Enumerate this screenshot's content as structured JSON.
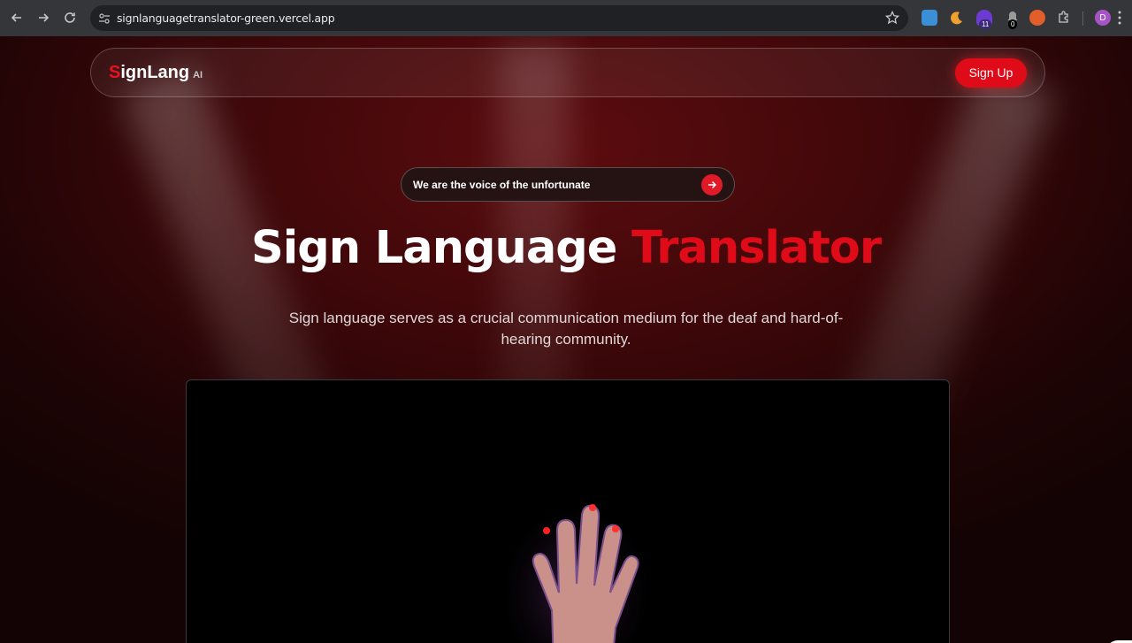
{
  "browser": {
    "url": "signlanguagetranslator-green.vercel.app",
    "extensions": [
      {
        "name": "bear-extension-icon",
        "color": "#3a8fd6"
      },
      {
        "name": "moon-extension-icon",
        "color": "#f0a12b"
      },
      {
        "name": "purple-extension-icon",
        "color": "#6c3bd1",
        "badge": "11"
      },
      {
        "name": "bell-extension-icon",
        "color": "#2a2a2a",
        "badge": "0"
      },
      {
        "name": "firefox-like-extension-icon",
        "color": "#e25e2a"
      }
    ],
    "profile_initial": "D"
  },
  "nav": {
    "logo_s": "S",
    "logo_rest": "ignLang",
    "logo_ai": "AI",
    "signup_label": "Sign Up"
  },
  "tagline": {
    "text": "We are the voice of the unfortunate",
    "arrow_icon": "arrow-right-icon"
  },
  "hero": {
    "title_white": "Sign Language ",
    "title_red": "Translator"
  },
  "subtitle": "Sign language serves as a crucial communication medium for the deaf and hard-of-hearing community.",
  "colors": {
    "accent": "#e00b18",
    "background": "#3c0709"
  }
}
